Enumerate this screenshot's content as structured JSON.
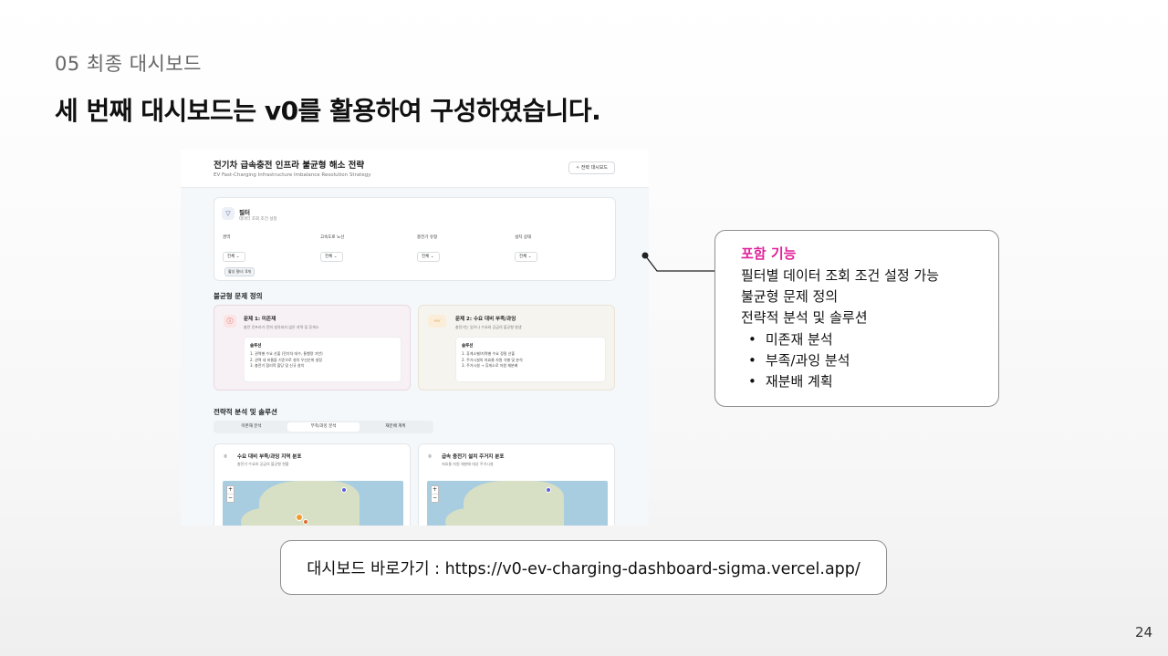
{
  "slide": {
    "section": "05  최종 대시보드",
    "headline": "세 번째 대시보드는 v0를 활용하여 구성하였습니다.",
    "page_number": "24",
    "link_text": "대시보드 바로가기 : https://v0-ev-charging-dashboard-sigma.vercel.app/"
  },
  "callout": {
    "title": "포함 기능",
    "lines": [
      "필터별 데이터 조회 조건 설정 가능",
      "불균형 문제 정의",
      "전략적 분석 및 솔루션"
    ],
    "bullets": [
      "미존재 분석",
      "부족/과잉 분석",
      "재분배 계획"
    ],
    "title_color": "#e0219a"
  },
  "dashboard": {
    "title": "전기차 급속충전 인프라 불균형 해소 전략",
    "subtitle": "EV Fast-Charging Infrastructure Imbalance Resolution Strategy",
    "strategy_button": "전략 대시보드",
    "filter": {
      "title": "필터",
      "subtitle": "데이터 조회 조건 설정",
      "groups": [
        {
          "label": "권역",
          "value": "전체"
        },
        {
          "label": "고속도로 노선",
          "value": "전체"
        },
        {
          "label": "충전기 유형",
          "value": "전체"
        },
        {
          "label": "설치 상태",
          "value": "전체"
        }
      ],
      "active_chip": "활성 필터: 0개"
    },
    "problem_section": "불균형 문제 정의",
    "problems": [
      {
        "title": "문제 1: 미존재",
        "subtitle": "충전 인프라가 전혀 설치되지 않은 지역 및 휴게소",
        "solution_title": "솔루션",
        "solutions": [
          "1. 권역별 수요 산출 (전기차 대수, 통행량 기반)",
          "2. 권역 내 비율을 기준으로 설치 우선순위 설정",
          "3. 충전기 합리적 할당 및 신규 설치"
        ]
      },
      {
        "title": "문제 2: 수요 대비 부족/과잉",
        "subtitle": "충전기는 있으나 수요와 공급의 불균형 발생",
        "solution_title": "솔루션",
        "solutions": [
          "1. 휴게소별/지역별 수요 정밀 산출",
          "2. 주거시설의 저효율 자원 식별 및 분석",
          "3. 주거시설 → 휴게소로 자원 재분배"
        ]
      }
    ],
    "strategy_section": "전략적 분석 및 솔루션",
    "tabs": [
      {
        "label": "미존재 분석",
        "active": false
      },
      {
        "label": "부족/과잉 분석",
        "active": true
      },
      {
        "label": "재분배 계획",
        "active": false
      }
    ],
    "maps": [
      {
        "title": "수요 대비 부족/과잉 지역 분포",
        "subtitle": "충전기 수요와 공급의 불균형 현황"
      },
      {
        "title": "급속 충전기 설치 주거지 분포",
        "subtitle": "저효율 자원 재분배 대상 주거시설"
      }
    ]
  }
}
